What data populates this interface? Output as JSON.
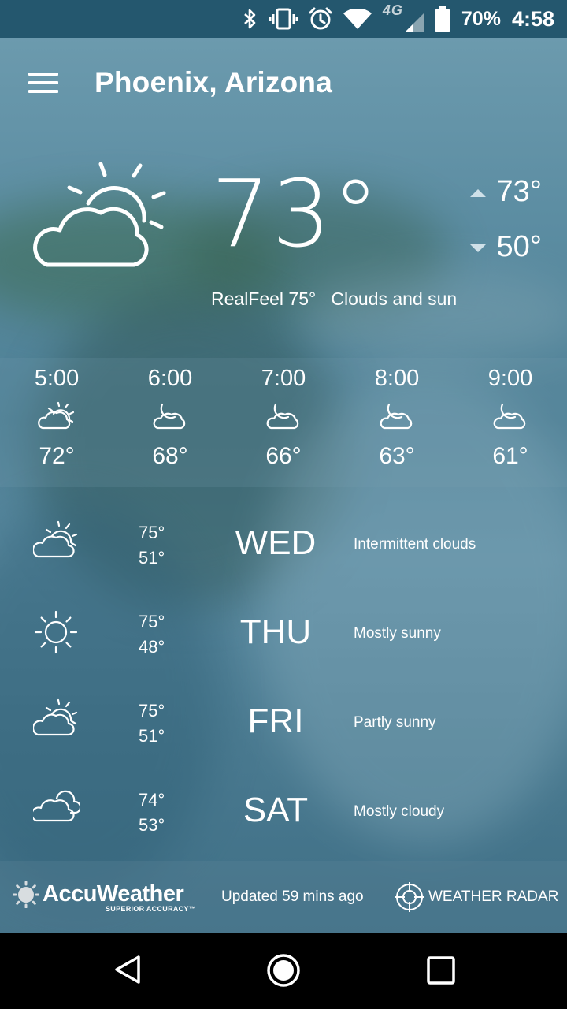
{
  "status_bar": {
    "battery": "70%",
    "time": "4:58",
    "network": "4G"
  },
  "header": {
    "city": "Phoenix, Arizona"
  },
  "current": {
    "temperature": "73°",
    "high": "73°",
    "low": "50°",
    "realfeel": "RealFeel 75°",
    "condition": "Clouds and sun",
    "icon": "partly-cloudy-sun-icon"
  },
  "hourly": [
    {
      "time": "5:00",
      "icon": "partly-cloudy-sun-icon",
      "temp": "72°"
    },
    {
      "time": "6:00",
      "icon": "cloud-moon-icon",
      "temp": "68°"
    },
    {
      "time": "7:00",
      "icon": "cloud-moon-icon",
      "temp": "66°"
    },
    {
      "time": "8:00",
      "icon": "cloud-moon-icon",
      "temp": "63°"
    },
    {
      "time": "9:00",
      "icon": "cloud-moon-icon",
      "temp": "61°"
    }
  ],
  "daily": [
    {
      "day": "WED",
      "high": "75°",
      "low": "51°",
      "condition": "Intermittent clouds",
      "icon": "partly-cloudy-sun-icon"
    },
    {
      "day": "THU",
      "high": "75°",
      "low": "48°",
      "condition": "Mostly sunny",
      "icon": "sun-icon"
    },
    {
      "day": "FRI",
      "high": "75°",
      "low": "51°",
      "condition": "Partly sunny",
      "icon": "partly-cloudy-sun-icon"
    },
    {
      "day": "SAT",
      "high": "74°",
      "low": "53°",
      "condition": "Mostly cloudy",
      "icon": "cloudy-icon"
    }
  ],
  "footer": {
    "brand": "AccuWeather",
    "tagline": "SUPERIOR ACCURACY™",
    "updated": "Updated 59 mins ago",
    "radar_label": "WEATHER RADAR"
  }
}
